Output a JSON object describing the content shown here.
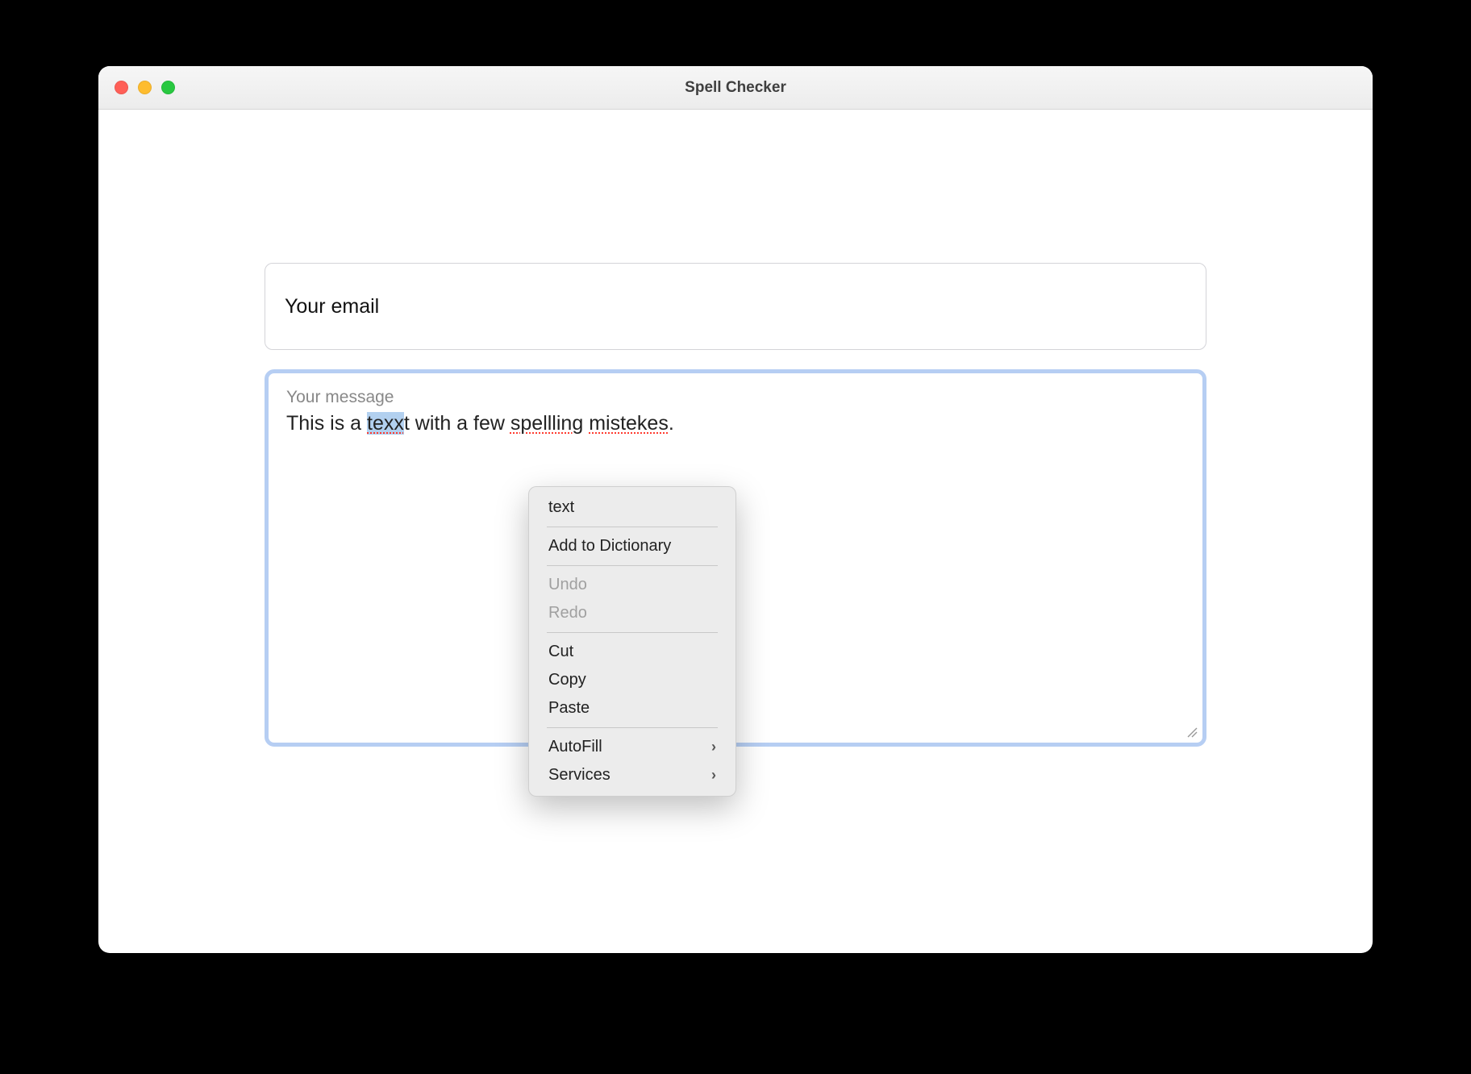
{
  "window": {
    "title": "Spell Checker"
  },
  "form": {
    "email_placeholder": "Your email",
    "message_label": "Your message",
    "message_text": {
      "prefix": "This is a ",
      "selected_misspelled": "texx",
      "mid1": "t with a few ",
      "misspelled2": "spellling",
      "mid2": " ",
      "misspelled3": "mistekes",
      "suffix": "."
    }
  },
  "context_menu": {
    "items": [
      {
        "label": "text",
        "enabled": true,
        "submenu": false
      },
      {
        "divider": true
      },
      {
        "label": "Add to Dictionary",
        "enabled": true,
        "submenu": false
      },
      {
        "divider": true
      },
      {
        "label": "Undo",
        "enabled": false,
        "submenu": false
      },
      {
        "label": "Redo",
        "enabled": false,
        "submenu": false
      },
      {
        "divider": true
      },
      {
        "label": "Cut",
        "enabled": true,
        "submenu": false
      },
      {
        "label": "Copy",
        "enabled": true,
        "submenu": false
      },
      {
        "label": "Paste",
        "enabled": true,
        "submenu": false
      },
      {
        "divider": true
      },
      {
        "label": "AutoFill",
        "enabled": true,
        "submenu": true
      },
      {
        "label": "Services",
        "enabled": true,
        "submenu": true
      }
    ]
  }
}
